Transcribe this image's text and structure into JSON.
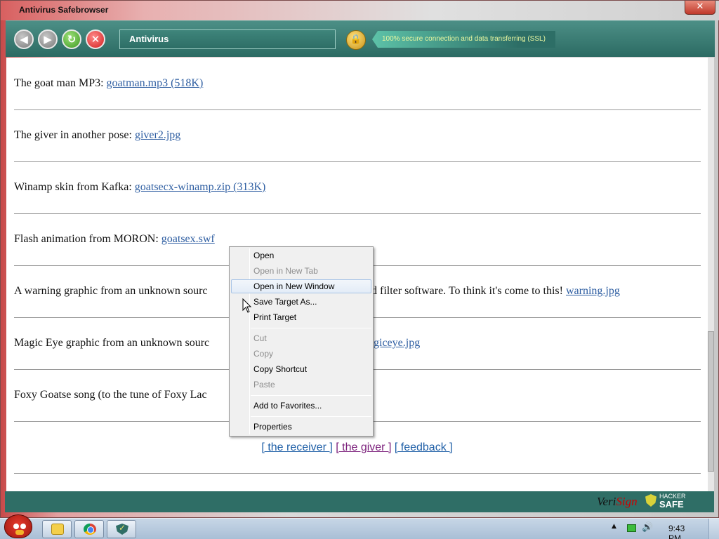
{
  "window": {
    "title": "Antivirus Safebrowser",
    "close_glyph": "✕"
  },
  "toolbar": {
    "back_glyph": "◀",
    "forward_glyph": "▶",
    "refresh_glyph": "↻",
    "stop_glyph": "✕",
    "address_text": "Antivirus",
    "lock_glyph": "🔒",
    "ssl_text": "100% secure connection and data transferring (SSL)"
  },
  "content": {
    "items": [
      {
        "text": "The goat man MP3: ",
        "link": "goatman.mp3 (518K)"
      },
      {
        "text": "The giver in another pose: ",
        "link": "giver2.jpg"
      },
      {
        "text": "Winamp skin from Kafka: ",
        "link": "goatsecx-winamp.zip (313K)"
      },
      {
        "text": "Flash animation from MORON: ",
        "link": "goatsex.swf"
      },
      {
        "text": "A warning graphic from an unknown sourc",
        "text2": "d filter software. To think it's come to this! ",
        "link": "warning.jpg"
      },
      {
        "text": "Magic Eye graphic from an unknown sourc",
        "link": "giceye.jpg"
      },
      {
        "text": "Foxy Goatse song (to the tune of Foxy Lac"
      }
    ],
    "footer_links": {
      "receiver": "[ the receiver ]",
      "giver": "[ the giver ]",
      "feedback": "[ feedback ]"
    }
  },
  "context_menu": {
    "items": [
      {
        "label": "Open",
        "disabled": false
      },
      {
        "label": "Open in New Tab",
        "disabled": true
      },
      {
        "label": "Open in New Window",
        "disabled": false,
        "highlighted": true
      },
      {
        "label": "Save Target As...",
        "disabled": false
      },
      {
        "label": "Print Target",
        "disabled": false
      },
      {
        "label": "Cut",
        "disabled": true
      },
      {
        "label": "Copy",
        "disabled": true
      },
      {
        "label": "Copy Shortcut",
        "disabled": false
      },
      {
        "label": "Paste",
        "disabled": true
      },
      {
        "label": "Add to Favorites...",
        "disabled": false
      },
      {
        "label": "Properties",
        "disabled": false
      }
    ]
  },
  "statusbar": {
    "verisign_a": "Veri",
    "verisign_b": "Sign",
    "hackersafe_top": "HACKER",
    "hackersafe_bottom": "SAFE"
  },
  "taskbar": {
    "clock": "9:43 PM",
    "tray_up_glyph": "▲",
    "volume_glyph": "🔊"
  },
  "colors": {
    "toolbar": "#2d6e66",
    "link": "#2d5da1",
    "visited_link": "#7b1f7b",
    "ssl_text": "#e9f7a0"
  }
}
